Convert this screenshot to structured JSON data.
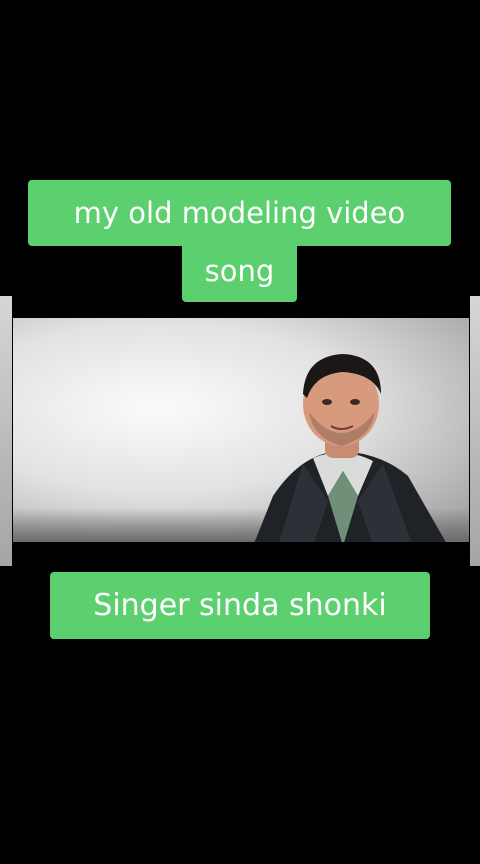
{
  "captions": {
    "line1": "my old modeling video",
    "line2": "song",
    "singer": "Singer sinda shonki"
  },
  "video": {
    "icon": "person-in-video-scene"
  },
  "colors": {
    "background": "#000000",
    "caption_background": "#5ccf6e",
    "caption_text": "#ffffff"
  }
}
